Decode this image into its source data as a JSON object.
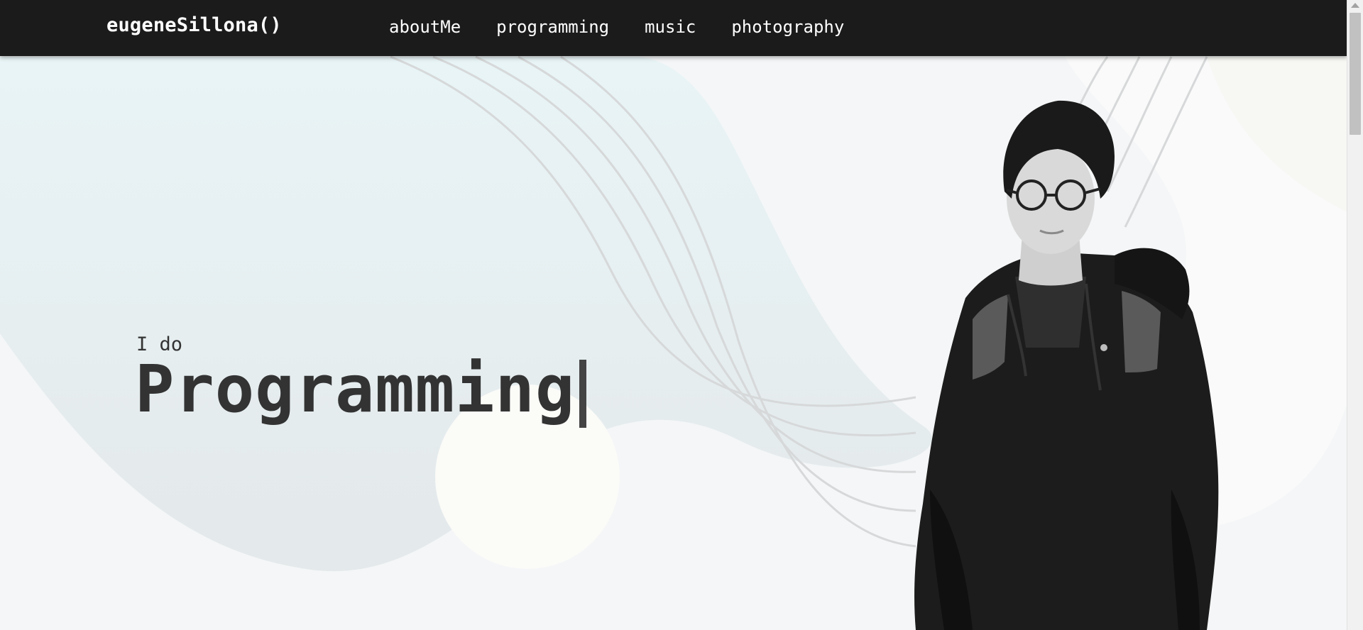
{
  "nav": {
    "brand": "eugeneSillona()",
    "links": [
      "aboutMe",
      "programming",
      "music",
      "photography"
    ]
  },
  "hero": {
    "pre_text": "I do",
    "typed_word": "Programming"
  },
  "colors": {
    "navbar_bg": "#1b1b1b",
    "text": "#333333",
    "background": "#f3f5f6"
  }
}
